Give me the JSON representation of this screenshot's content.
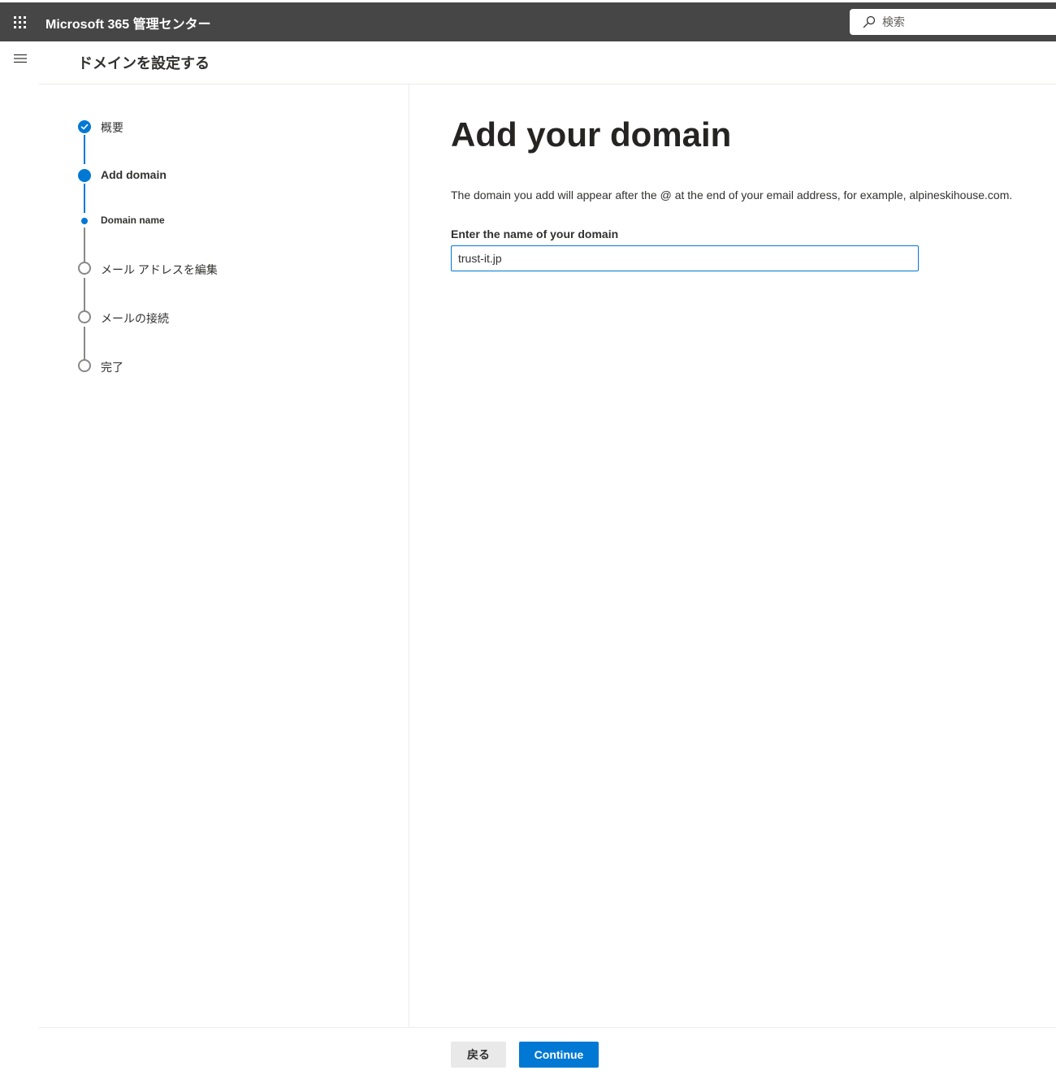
{
  "header": {
    "app_title": "Microsoft 365 管理センター",
    "search_placeholder": "検索",
    "colors": {
      "bar": "#464646",
      "accent": "#0078d4"
    }
  },
  "page": {
    "title": "ドメインを設定する"
  },
  "stepper": {
    "steps": [
      {
        "label": "概要",
        "status": "completed"
      },
      {
        "label": "Add domain",
        "status": "current"
      },
      {
        "label": "Domain name",
        "status": "current-substep"
      },
      {
        "label": "メール アドレスを編集",
        "status": "pending"
      },
      {
        "label": "メールの接続",
        "status": "pending"
      },
      {
        "label": "完了",
        "status": "pending"
      }
    ]
  },
  "main": {
    "heading": "Add your domain",
    "description": "The domain you add will appear after the @ at the end of your email address, for example, alpineskihouse.com.",
    "field_label": "Enter the name of your domain",
    "field_value": "trust-it.jp"
  },
  "footer": {
    "back_label": "戻る",
    "continue_label": "Continue"
  },
  "icons": [
    "app-launcher-icon",
    "search-icon",
    "hamburger-menu-icon",
    "checkmark-icon"
  ]
}
